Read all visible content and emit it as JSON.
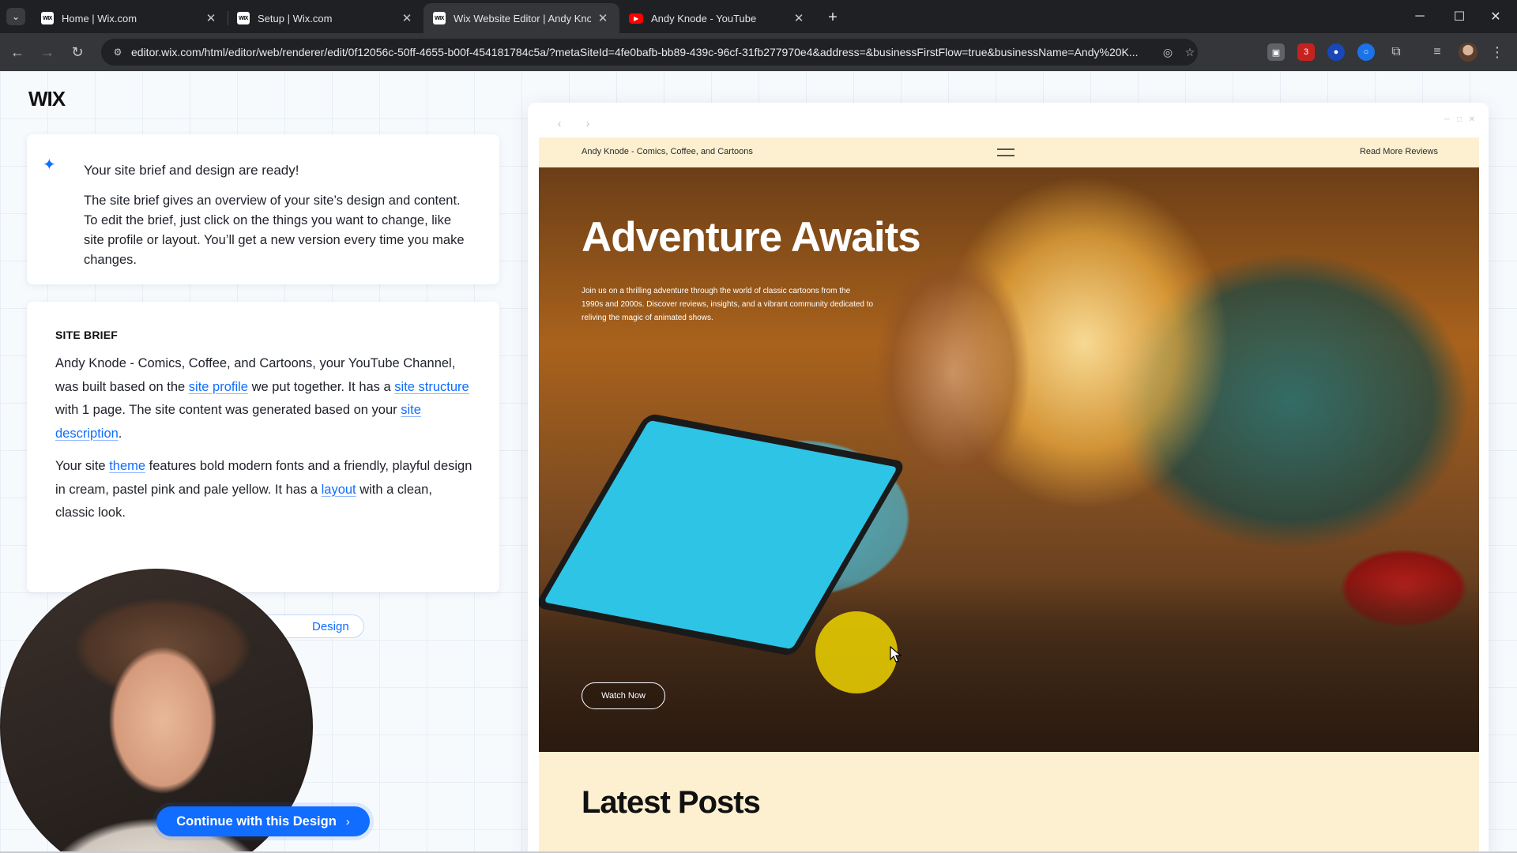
{
  "browser": {
    "tabs": [
      {
        "title": "Home | Wix.com",
        "favicon": "WIX",
        "active": false
      },
      {
        "title": "Setup | Wix.com",
        "favicon": "WIX",
        "active": false
      },
      {
        "title": "Wix Website Editor | Andy Knode",
        "favicon": "WIX",
        "active": true
      },
      {
        "title": "Andy Knode - YouTube",
        "favicon": "▶",
        "active": false
      }
    ],
    "url": "editor.wix.com/html/editor/web/renderer/edit/0f12056c-50ff-4655-b00f-454181784c5a/?metaSiteId=4fe0bafb-bb89-439c-96cf-31fb277970e4&address=&businessFirstFlow=true&businessName=Andy%20K...",
    "ext_badge": "3",
    "icons": {
      "tab_menu": "chevron-down-icon",
      "close": "close-icon",
      "new_tab": "plus-icon",
      "back": "back-arrow-icon",
      "forward": "forward-arrow-icon",
      "reload": "reload-icon",
      "site_info": "site-info-icon",
      "eye_off": "eye-off-icon",
      "star": "star-icon"
    }
  },
  "editor": {
    "logo": "WIX",
    "intro": {
      "title": "Your site brief and design are ready!",
      "body": "The site brief gives an overview of your site’s design and content. To edit the brief, just click on the things you want to change, like site profile or layout. You’ll get a new version every time you make changes."
    },
    "brief": {
      "label": "SITE BRIEF",
      "p1_a": "Andy Knode - Comics, Coffee, and Cartoons, your YouTube Channel, was built based on the ",
      "p1_link1": "site profile",
      "p1_b": " we put together. It has a ",
      "p1_link2": "site structure",
      "p1_c": " with 1 page. The site content was generated based on your ",
      "p1_link3": "site description",
      "p1_d": ".",
      "p2_a": "Your site ",
      "p2_link1": "theme",
      "p2_b": " features bold modern fonts and a friendly, playful design in cream, pastel pink and pale yellow. It has a ",
      "p2_link2": "layout",
      "p2_c": " with a clean, classic look.",
      "pill_visible": "Design"
    },
    "continue_label": "Continue with this Design",
    "continue_chevron": "›",
    "accent": "#116dff"
  },
  "site": {
    "name": "Andy Knode - Comics, Coffee, and Cartoons",
    "header_link": "Read More Reviews",
    "hero_title": "Adventure Awaits",
    "hero_subtitle": "Join us on a thrilling adventure through the world of classic cartoons from the 1990s and 2000s. Discover reviews, insights, and a vibrant community dedicated to reliving the magic of animated shows.",
    "watch_label": "Watch Now",
    "posts_title": "Latest Posts",
    "bg": "#fdf0d0"
  }
}
